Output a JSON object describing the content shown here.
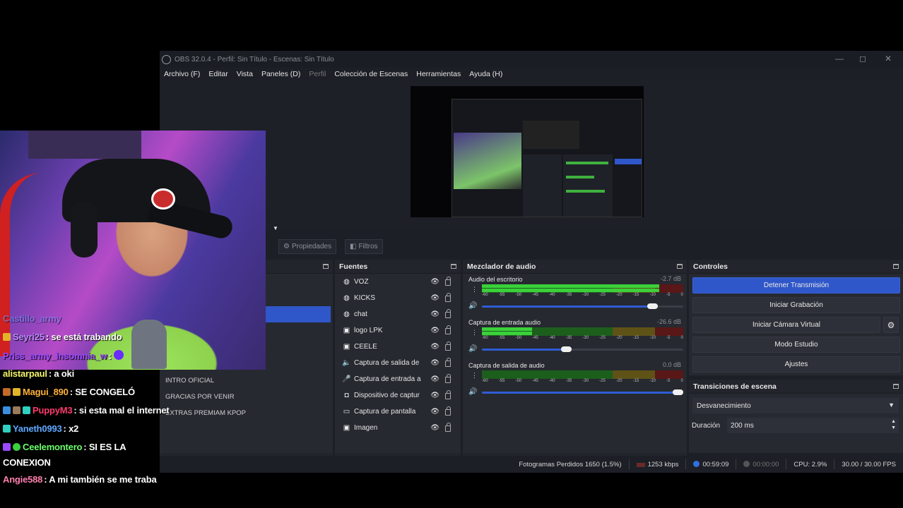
{
  "window": {
    "title": "OBS 32.0.4 - Perfil: Sin Título - Escenas: Sin Título",
    "minimize": "—",
    "maximize": "◻",
    "close": "✕"
  },
  "menu": [
    "Archivo (F)",
    "Editar",
    "Vista",
    "Paneles (D)",
    "Perfil",
    "Colección de Escenas",
    "Herramientas",
    "Ayuda (H)"
  ],
  "toolbar": {
    "properties": "Propiedades",
    "filters": "Filtros"
  },
  "scenes": {
    "items": [
      "INTRO OFICIAL",
      "GRACIAS POR VENIR",
      "EXTRAS PREMIAM KPOP"
    ]
  },
  "sources": {
    "title": "Fuentes",
    "items": [
      {
        "label": "VOZ",
        "icon": "globe-icon"
      },
      {
        "label": "KICKS",
        "icon": "globe-icon"
      },
      {
        "label": "chat",
        "icon": "globe-icon"
      },
      {
        "label": "logo LPK",
        "icon": "image-icon"
      },
      {
        "label": "CEELE",
        "icon": "image-icon"
      },
      {
        "label": "Captura de salida de",
        "icon": "speaker-icon"
      },
      {
        "label": "Captura de entrada a",
        "icon": "mic-icon"
      },
      {
        "label": "Dispositivo de captur",
        "icon": "camera-icon"
      },
      {
        "label": "Captura de pantalla",
        "icon": "monitor-icon"
      },
      {
        "label": "Imagen",
        "icon": "image-icon"
      }
    ]
  },
  "mixer": {
    "title": "Mezclador de audio",
    "scale": [
      "-60",
      "-55",
      "-50",
      "-45",
      "-40",
      "-35",
      "-30",
      "-25",
      "-20",
      "-15",
      "-10",
      "-5",
      "0"
    ],
    "channels": [
      {
        "name": "Audio del escritorio",
        "db": "-2.7 dB",
        "level": 0.88,
        "volume": 0.85
      },
      {
        "name": "Captura de entrada audio",
        "db": "-26.6 dB",
        "level": 0.25,
        "volume": 0.42
      },
      {
        "name": "Captura de salida de audio",
        "db": "0.0 dB",
        "level": 0.0,
        "volume": 1.0
      }
    ]
  },
  "controls": {
    "title": "Controles",
    "stop_stream": "Detener Transmisión",
    "start_recording": "Iniciar Grabación",
    "start_virtual_cam": "Iniciar Cámara Virtual",
    "studio_mode": "Modo Estudio",
    "settings": "Ajustes"
  },
  "transitions": {
    "title": "Transiciones de escena",
    "selected": "Desvanecimiento",
    "duration_label": "Duración",
    "duration_value": "200 ms"
  },
  "status": {
    "dropped_frames": "Fotogramas Perdidos 1650 (1.5%)",
    "bitrate": "1253 kbps",
    "stream_time": "00:59:09",
    "rec_time": "00:00:00",
    "cpu": "CPU: 2.9%",
    "fps": "30.00 / 30.00 FPS"
  },
  "chat": [
    {
      "user": "Castillo_army",
      "text": "",
      "user_color": "#7d8bff"
    },
    {
      "user": "Seyri25",
      "text": ": se está trabando",
      "user_color": "#b98bff"
    },
    {
      "user": "Priss_army_insomnia_w",
      "text": ":",
      "user_color": "#9a4bff"
    },
    {
      "user": "alistarpaul",
      "text": ": a oki",
      "user_color": "#f3f36a"
    },
    {
      "user": "Magui_890",
      "text": ": SE CONGELÓ",
      "user_color": "#ffb13b"
    },
    {
      "user": "PuppyM3",
      "text": ": si esta mal el internet",
      "user_color": "#ff3b6d"
    },
    {
      "user": "Yaneth0993",
      "text": ": x2",
      "user_color": "#5fa8ff"
    },
    {
      "user": "Ceelemontero",
      "text": ": SI ES LA",
      "user_color": "#6cff6c"
    },
    {
      "user": "",
      "text": "CONEXION",
      "user_color": "#ffffff"
    },
    {
      "user": "Angie588",
      "text": ": A mi también se me traba",
      "user_color": "#ff7fae"
    }
  ]
}
